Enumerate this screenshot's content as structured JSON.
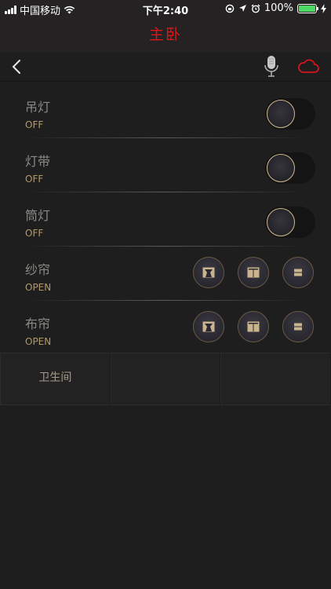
{
  "status_bar": {
    "carrier": "中国移动",
    "time": "下午2:40",
    "battery": "100%",
    "battery_level": 1.0,
    "icons": [
      "signal-icon",
      "wifi-icon",
      "rotation-lock-icon",
      "location-icon",
      "alarm-icon",
      "battery-icon",
      "charging-icon"
    ]
  },
  "header": {
    "title": "主卧",
    "title_color": "#e01515"
  },
  "toolbar": {
    "icons": [
      "back-icon",
      "microphone-icon",
      "cloud-icon"
    ],
    "cloud_color": "#d8141b"
  },
  "devices": [
    {
      "name": "吊灯",
      "state": "OFF",
      "control": "toggle",
      "on": false
    },
    {
      "name": "灯带",
      "state": "OFF",
      "control": "toggle",
      "on": false
    },
    {
      "name": "筒灯",
      "state": "OFF",
      "control": "toggle",
      "on": false
    },
    {
      "name": "纱帘",
      "state": "OPEN",
      "control": "curtain",
      "buttons": [
        "curtain-open-icon",
        "curtain-close-icon",
        "curtain-stop-icon"
      ]
    },
    {
      "name": "布帘",
      "state": "OPEN",
      "control": "curtain",
      "buttons": [
        "curtain-open-icon",
        "curtain-close-icon",
        "curtain-stop-icon"
      ]
    }
  ],
  "rooms": [
    {
      "label": "卫生间"
    },
    {
      "label": ""
    },
    {
      "label": ""
    }
  ],
  "colors": {
    "accent_gold": "#d0b98d",
    "state_text": "#b69a66",
    "label_text": "#8b8a86",
    "background": "#1e1e1e"
  }
}
